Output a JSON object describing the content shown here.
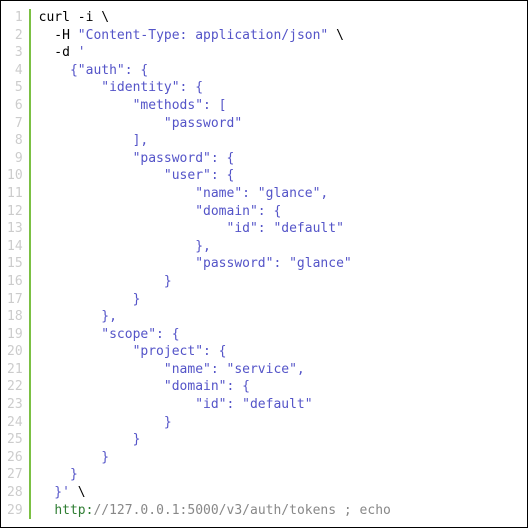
{
  "lines": [
    {
      "n": 1,
      "segs": [
        {
          "cls": "tok-cmd",
          "t": "curl -i \\"
        }
      ]
    },
    {
      "n": 2,
      "segs": [
        {
          "cls": "tok-cmd",
          "t": "  -H "
        },
        {
          "cls": "tok-str",
          "t": "\"Content-Type: application/json\""
        },
        {
          "cls": "tok-cmd",
          "t": " \\"
        }
      ]
    },
    {
      "n": 3,
      "segs": [
        {
          "cls": "tok-cmd",
          "t": "  -d "
        },
        {
          "cls": "tok-str",
          "t": "'"
        }
      ]
    },
    {
      "n": 4,
      "segs": [
        {
          "cls": "tok-str",
          "t": "    {\"auth\": {"
        }
      ]
    },
    {
      "n": 5,
      "segs": [
        {
          "cls": "tok-str",
          "t": "        \"identity\": {"
        }
      ]
    },
    {
      "n": 6,
      "segs": [
        {
          "cls": "tok-str",
          "t": "            \"methods\": ["
        }
      ]
    },
    {
      "n": 7,
      "segs": [
        {
          "cls": "tok-str",
          "t": "                \"password\""
        }
      ]
    },
    {
      "n": 8,
      "segs": [
        {
          "cls": "tok-str",
          "t": "            ],"
        }
      ]
    },
    {
      "n": 9,
      "segs": [
        {
          "cls": "tok-str",
          "t": "            \"password\": {"
        }
      ]
    },
    {
      "n": 10,
      "segs": [
        {
          "cls": "tok-str",
          "t": "                \"user\": {"
        }
      ]
    },
    {
      "n": 11,
      "segs": [
        {
          "cls": "tok-str",
          "t": "                    \"name\": \"glance\","
        }
      ]
    },
    {
      "n": 12,
      "segs": [
        {
          "cls": "tok-str",
          "t": "                    \"domain\": {"
        }
      ]
    },
    {
      "n": 13,
      "segs": [
        {
          "cls": "tok-str",
          "t": "                        \"id\": \"default\""
        }
      ]
    },
    {
      "n": 14,
      "segs": [
        {
          "cls": "tok-str",
          "t": "                    },"
        }
      ]
    },
    {
      "n": 15,
      "segs": [
        {
          "cls": "tok-str",
          "t": "                    \"password\": \"glance\""
        }
      ]
    },
    {
      "n": 16,
      "segs": [
        {
          "cls": "tok-str",
          "t": "                }"
        }
      ]
    },
    {
      "n": 17,
      "segs": [
        {
          "cls": "tok-str",
          "t": "            }"
        }
      ]
    },
    {
      "n": 18,
      "segs": [
        {
          "cls": "tok-str",
          "t": "        },"
        }
      ]
    },
    {
      "n": 19,
      "segs": [
        {
          "cls": "tok-str",
          "t": "        \"scope\": {"
        }
      ]
    },
    {
      "n": 20,
      "segs": [
        {
          "cls": "tok-str",
          "t": "            \"project\": {"
        }
      ]
    },
    {
      "n": 21,
      "segs": [
        {
          "cls": "tok-str",
          "t": "                \"name\": \"service\","
        }
      ]
    },
    {
      "n": 22,
      "segs": [
        {
          "cls": "tok-str",
          "t": "                \"domain\": {"
        }
      ]
    },
    {
      "n": 23,
      "segs": [
        {
          "cls": "tok-str",
          "t": "                    \"id\": \"default\""
        }
      ]
    },
    {
      "n": 24,
      "segs": [
        {
          "cls": "tok-str",
          "t": "                }"
        }
      ]
    },
    {
      "n": 25,
      "segs": [
        {
          "cls": "tok-str",
          "t": "            }"
        }
      ]
    },
    {
      "n": 26,
      "segs": [
        {
          "cls": "tok-str",
          "t": "        }"
        }
      ]
    },
    {
      "n": 27,
      "segs": [
        {
          "cls": "tok-str",
          "t": "    }"
        }
      ]
    },
    {
      "n": 28,
      "segs": [
        {
          "cls": "tok-str",
          "t": "  }'"
        },
        {
          "cls": "tok-cmd",
          "t": " \\"
        }
      ]
    },
    {
      "n": 29,
      "segs": [
        {
          "cls": "tok-cmd",
          "t": "  "
        },
        {
          "cls": "tok-url1",
          "t": "http:"
        },
        {
          "cls": "tok-url2",
          "t": "//127.0.0.1:5000/v3/auth/tokens ; echo"
        }
      ]
    }
  ]
}
